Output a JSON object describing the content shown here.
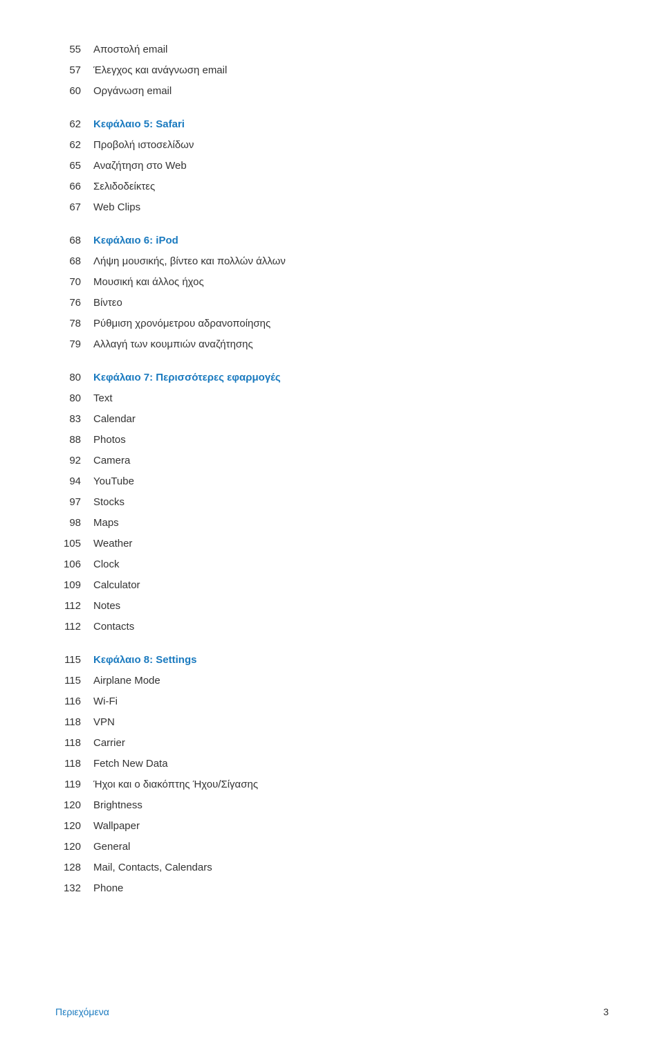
{
  "entries": [
    {
      "number": "55",
      "text": "Αποστολή email",
      "isChapter": false
    },
    {
      "number": "57",
      "text": "Έλεγχος και ανάγνωση email",
      "isChapter": false
    },
    {
      "number": "60",
      "text": "Οργάνωση email",
      "isChapter": false
    },
    {
      "spacer": true
    },
    {
      "number": "62",
      "text": "Κεφάλαιο 5: Safari",
      "isChapter": true
    },
    {
      "number": "62",
      "text": "Προβολή ιστοσελίδων",
      "isChapter": false
    },
    {
      "number": "65",
      "text": "Αναζήτηση στο Web",
      "isChapter": false
    },
    {
      "number": "66",
      "text": "Σελιδοδείκτες",
      "isChapter": false
    },
    {
      "number": "67",
      "text": "Web Clips",
      "isChapter": false
    },
    {
      "spacer": true
    },
    {
      "number": "68",
      "text": "Κεφάλαιο 6: iPod",
      "isChapter": true
    },
    {
      "number": "68",
      "text": "Λήψη μουσικής, βίντεο και πολλών άλλων",
      "isChapter": false
    },
    {
      "number": "70",
      "text": "Μουσική και άλλος ήχος",
      "isChapter": false
    },
    {
      "number": "76",
      "text": "Βίντεο",
      "isChapter": false
    },
    {
      "number": "78",
      "text": "Ρύθμιση χρονόμετρου αδρανοποίησης",
      "isChapter": false
    },
    {
      "number": "79",
      "text": "Αλλαγή των κουμπιών αναζήτησης",
      "isChapter": false
    },
    {
      "spacer": true
    },
    {
      "number": "80",
      "text": "Κεφάλαιο 7: Περισσότερες εφαρμογές",
      "isChapter": true
    },
    {
      "number": "80",
      "text": "Text",
      "isChapter": false
    },
    {
      "number": "83",
      "text": "Calendar",
      "isChapter": false
    },
    {
      "number": "88",
      "text": "Photos",
      "isChapter": false
    },
    {
      "number": "92",
      "text": "Camera",
      "isChapter": false
    },
    {
      "number": "94",
      "text": "YouTube",
      "isChapter": false
    },
    {
      "number": "97",
      "text": "Stocks",
      "isChapter": false
    },
    {
      "number": "98",
      "text": "Maps",
      "isChapter": false
    },
    {
      "number": "105",
      "text": "Weather",
      "isChapter": false
    },
    {
      "number": "106",
      "text": "Clock",
      "isChapter": false
    },
    {
      "number": "109",
      "text": "Calculator",
      "isChapter": false
    },
    {
      "number": "112",
      "text": "Notes",
      "isChapter": false
    },
    {
      "number": "112",
      "text": "Contacts",
      "isChapter": false
    },
    {
      "spacer": true
    },
    {
      "number": "115",
      "text": "Κεφάλαιο 8: Settings",
      "isChapter": true
    },
    {
      "number": "115",
      "text": "Airplane Mode",
      "isChapter": false
    },
    {
      "number": "116",
      "text": "Wi-Fi",
      "isChapter": false
    },
    {
      "number": "118",
      "text": "VPN",
      "isChapter": false
    },
    {
      "number": "118",
      "text": "Carrier",
      "isChapter": false
    },
    {
      "number": "118",
      "text": "Fetch New Data",
      "isChapter": false
    },
    {
      "number": "119",
      "text": "Ήχοι και ο διακόπτης Ήχου/Σίγασης",
      "isChapter": false
    },
    {
      "number": "120",
      "text": "Brightness",
      "isChapter": false
    },
    {
      "number": "120",
      "text": "Wallpaper",
      "isChapter": false
    },
    {
      "number": "120",
      "text": "General",
      "isChapter": false
    },
    {
      "number": "128",
      "text": "Mail, Contacts, Calendars",
      "isChapter": false
    },
    {
      "number": "132",
      "text": "Phone",
      "isChapter": false
    }
  ],
  "footer": {
    "label": "Περιεχόμενα",
    "page": "3"
  }
}
